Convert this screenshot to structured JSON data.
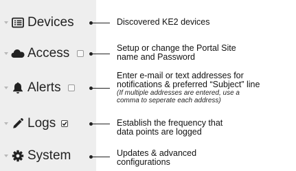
{
  "sidebar": {
    "items": [
      {
        "label": "Devices",
        "icon": "list-icon",
        "checkbox": null
      },
      {
        "label": "Access",
        "icon": "cloud-icon",
        "checkbox": "unchecked"
      },
      {
        "label": "Alerts",
        "icon": "bell-icon",
        "checkbox": "unchecked"
      },
      {
        "label": "Logs",
        "icon": "pencil-icon",
        "checkbox": "checked"
      },
      {
        "label": "System",
        "icon": "gear-icon",
        "checkbox": null
      }
    ]
  },
  "descriptions": {
    "devices": "Discovered KE2 devices",
    "access_line1": "Setup or change the Portal Site",
    "access_line2": "name and Password",
    "alerts_line1": "Enter e-mail or text addresses for",
    "alerts_line2": "notifications & preferred “Subject” line",
    "alerts_note1": "(If multiple addresses are entered, use a",
    "alerts_note2": "comma to seperate each address)",
    "logs_line1": "Establish the frequency that",
    "logs_line2": "data points are logged",
    "system_line1": "Updates & advanced",
    "system_line2": "configurations"
  },
  "colors": {
    "sidebar_bg": "#eeeeee",
    "text": "#222222",
    "caret": "#b8b8b8"
  }
}
